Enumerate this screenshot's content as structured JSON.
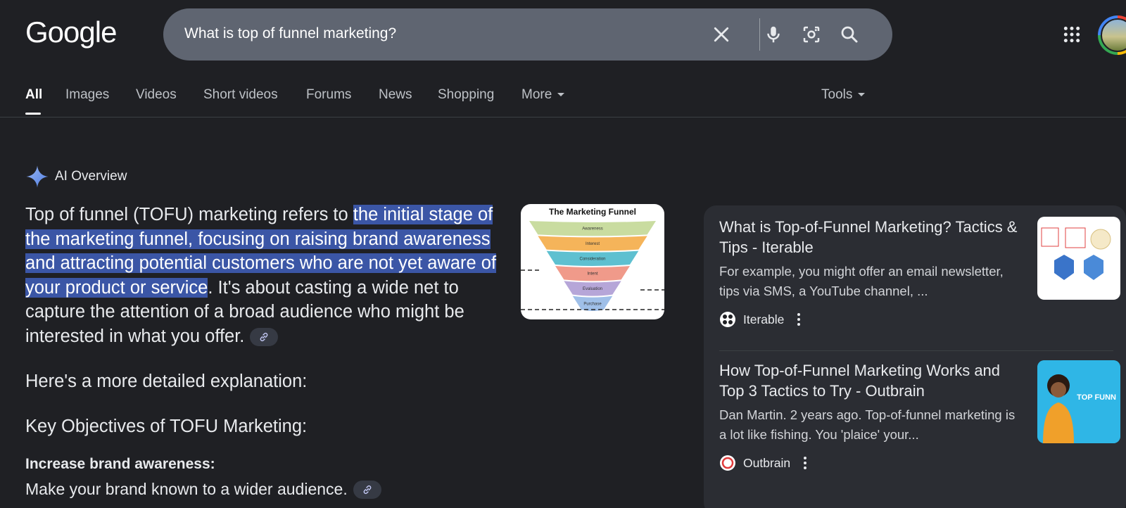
{
  "header": {
    "logo": "Google",
    "search_query": "What is top of funnel marketing?",
    "clear_label": "Clear",
    "voice_label": "Search by voice",
    "lens_label": "Search by image",
    "search_label": "Search"
  },
  "tabs": [
    {
      "label": "All",
      "active": true
    },
    {
      "label": "Images"
    },
    {
      "label": "Videos"
    },
    {
      "label": "Short videos"
    },
    {
      "label": "Forums"
    },
    {
      "label": "News"
    },
    {
      "label": "Shopping"
    },
    {
      "label": "More"
    }
  ],
  "tools_label": "Tools",
  "ai_overview": {
    "label": "AI Overview",
    "intro_plain": "Top of funnel (TOFU) marketing refers to ",
    "intro_highlight": "the initial stage of the marketing funnel, focusing on raising brand awareness and attracting potential customers who are not yet aware of your product or service",
    "intro_rest": ". It's about casting a wide net to capture the attention of a broad audience who might be interested in what you offer.",
    "detail_intro": "Here's a more detailed explanation:",
    "key_objectives_heading": "Key Objectives of TOFU Marketing:",
    "bullets": [
      {
        "heading": "Increase brand awareness:",
        "text": "Make your brand known to a wider audience."
      }
    ],
    "funnel_image": {
      "title": "The Marketing Funnel",
      "stages": [
        "Awareness",
        "Interest",
        "Consideration",
        "Intent",
        "Evaluation",
        "Purchase"
      ],
      "colors": [
        "#c9dca0",
        "#f5b45a",
        "#5ec0d0",
        "#f09a8a",
        "#b6a6d8",
        "#9fbfe8"
      ]
    }
  },
  "sources": [
    {
      "title": "What is Top-of-Funnel Marketing? Tactics & Tips - Iterable",
      "snippet": "For example, you might offer an email newsletter, tips via SMS, a YouTube channel, ...",
      "source": "Iterable"
    },
    {
      "title": "How Top-of-Funnel Marketing Works and Top 3 Tactics to Try - Outbrain",
      "snippet": "Dan Martin. 2 years ago. Top-of-funnel marketing is a lot like fishing. You 'plaice' your...",
      "source": "Outbrain",
      "thumb_text": "TOP FUNN"
    }
  ]
}
